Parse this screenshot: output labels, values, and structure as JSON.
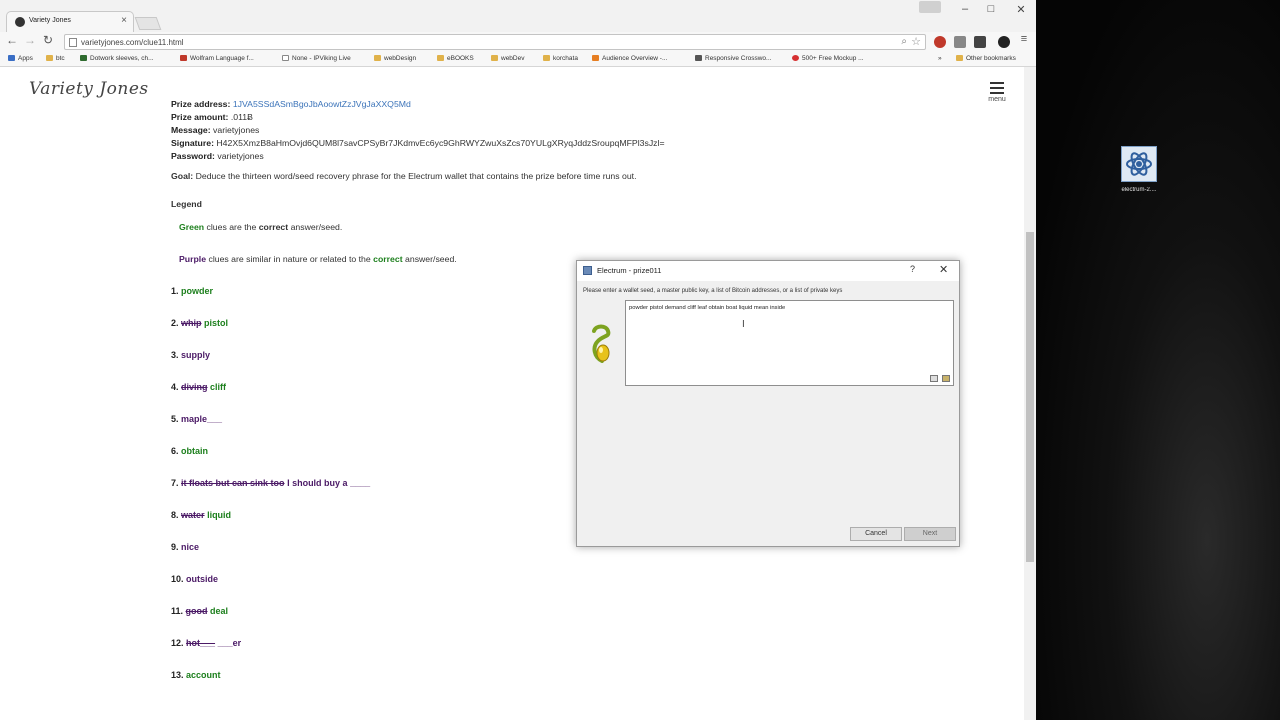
{
  "browser": {
    "tab_title": "Variety Jones",
    "url": "varietyjones.com/clue11.html",
    "bookmarks": [
      {
        "label": "Apps",
        "color": "#3a6ec5"
      },
      {
        "label": "btc",
        "color": "#e0b24a"
      },
      {
        "label": "Dotwork sleeves, ch...",
        "color": "#2f6b2f"
      },
      {
        "label": "Wolfram Language f...",
        "color": "#c0392b"
      },
      {
        "label": "None - IPViking Live",
        "color": "#ffffff"
      },
      {
        "label": "webDesign",
        "color": "#e0b24a"
      },
      {
        "label": "eBOOKS",
        "color": "#e0b24a"
      },
      {
        "label": "webDev",
        "color": "#e0b24a"
      },
      {
        "label": "korchata",
        "color": "#e0b24a"
      },
      {
        "label": "Audience Overview -...",
        "color": "#e67e22"
      },
      {
        "label": "Responsive Crosswo...",
        "color": "#555555"
      },
      {
        "label": "500+ Free Mockup ...",
        "color": "#d63031"
      }
    ],
    "bookmarks_more": "»",
    "other_bookmarks": "Other bookmarks"
  },
  "site": {
    "logo": "Variety Jones",
    "menu_label": "menu"
  },
  "prize": {
    "address_label": "Prize address:",
    "address_value": "1JVA5SSdASmBgoJbAoowtZzJVgJaXXQ5Md",
    "amount_label": "Prize amount:",
    "amount_value": ".011Ƀ",
    "message_label": "Message:",
    "message_value": "varietyjones",
    "signature_label": "Signature:",
    "signature_value": "H42X5XmzB8aHmOvjd6QUM8l7savCPSyBr7JKdmvEc6yc9GhRWYZwuXsZcs70YULgXRyqJddzSroupqMFPl3sJzl=",
    "password_label": "Password:",
    "password_value": "varietyjones",
    "goal_label": "Goal:",
    "goal_value": "Deduce the thirteen word/seed recovery phrase for the Electrum wallet that contains the prize before time runs out."
  },
  "legend": {
    "heading": "Legend",
    "green_word": "Green",
    "green_text_1": "clues are the",
    "green_correct": "correct",
    "green_text_2": "answer/seed.",
    "purple_word": "Purple",
    "purple_text_1": "clues are similar in nature or related to the",
    "purple_correct": "correct",
    "purple_text_2": "answer/seed."
  },
  "clues": [
    {
      "num": "1.",
      "purple": "",
      "strike": "",
      "green": "powder"
    },
    {
      "num": "2.",
      "purple": "",
      "strike": "whip",
      "green": "pistol"
    },
    {
      "num": "3.",
      "purple": "supply",
      "strike": "",
      "green": ""
    },
    {
      "num": "4.",
      "purple": "",
      "strike": "diving",
      "green": "cliff"
    },
    {
      "num": "5.",
      "purple": "maple___",
      "strike": "",
      "green": ""
    },
    {
      "num": "6.",
      "purple": "",
      "strike": "",
      "green": "obtain"
    },
    {
      "num": "7.",
      "purple": "I should buy a ____",
      "strike": "it floats but can sink too",
      "green": ""
    },
    {
      "num": "8.",
      "purple": "",
      "strike": "water",
      "green": "liquid"
    },
    {
      "num": "9.",
      "purple": "nice",
      "strike": "",
      "green": ""
    },
    {
      "num": "10.",
      "purple": "outside",
      "strike": "",
      "green": ""
    },
    {
      "num": "11.",
      "purple": "",
      "strike": "good",
      "green": "deal"
    },
    {
      "num": "12.",
      "purple": "___er",
      "strike": "hot___",
      "green": ""
    },
    {
      "num": "13.",
      "purple": "",
      "strike": "",
      "green": "account"
    }
  ],
  "dialog": {
    "title": "Electrum  -  prize011",
    "help": "?",
    "close": "✕",
    "prompt": "Please enter a wallet seed, a master public key, a list of Bitcoin addresses, or a list of private keys",
    "seed_text": "powder pistol demand cliff leaf obtain boat liquid mean inside",
    "cancel": "Cancel",
    "next": "Next"
  },
  "desktop": {
    "icon_label": "electrum-2...."
  }
}
